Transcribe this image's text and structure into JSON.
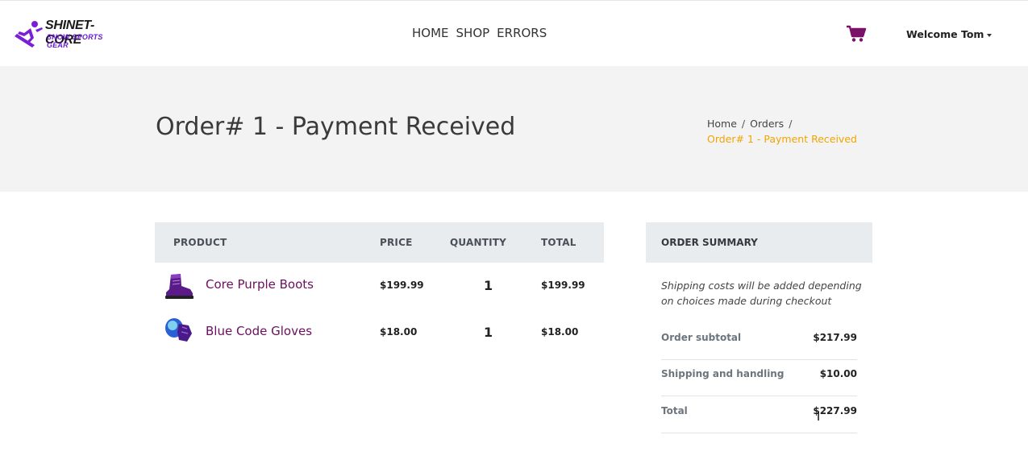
{
  "brand": {
    "name": "SHINET-CORE",
    "tagline": "SNOW SPORTS GEAR"
  },
  "nav": {
    "home": "HOME",
    "shop": "SHOP",
    "errors": "ERRORS"
  },
  "user": {
    "welcome": "Welcome Tom"
  },
  "page": {
    "title": "Order# 1 - Payment Received",
    "breadcrumb": {
      "home": "Home",
      "orders": "Orders",
      "current": "Order# 1 - Payment Received",
      "separator": "/"
    }
  },
  "table": {
    "headers": {
      "product": "PRODUCT",
      "price": "PRICE",
      "quantity": "QUANTITY",
      "total": "TOTAL"
    },
    "rows": [
      {
        "name": "Core Purple Boots",
        "price": "$199.99",
        "quantity": "1",
        "total": "$199.99",
        "icon": "boot-icon"
      },
      {
        "name": "Blue Code Gloves",
        "price": "$18.00",
        "quantity": "1",
        "total": "$18.00",
        "icon": "gloves-icon"
      }
    ]
  },
  "summary": {
    "title": "ORDER SUMMARY",
    "note": "Shipping costs will be added depending on choices made during checkout",
    "lines": [
      {
        "label": "Order subtotal",
        "value": "$217.99"
      },
      {
        "label": "Shipping and handling",
        "value": "$10.00"
      },
      {
        "label": "Total",
        "value": "$227.99"
      }
    ]
  },
  "colors": {
    "accent": "#7a1068",
    "breadcrumb_active": "#f0a500",
    "banner_bg": "#f3f3f4",
    "table_head_bg": "#e9ecef"
  }
}
